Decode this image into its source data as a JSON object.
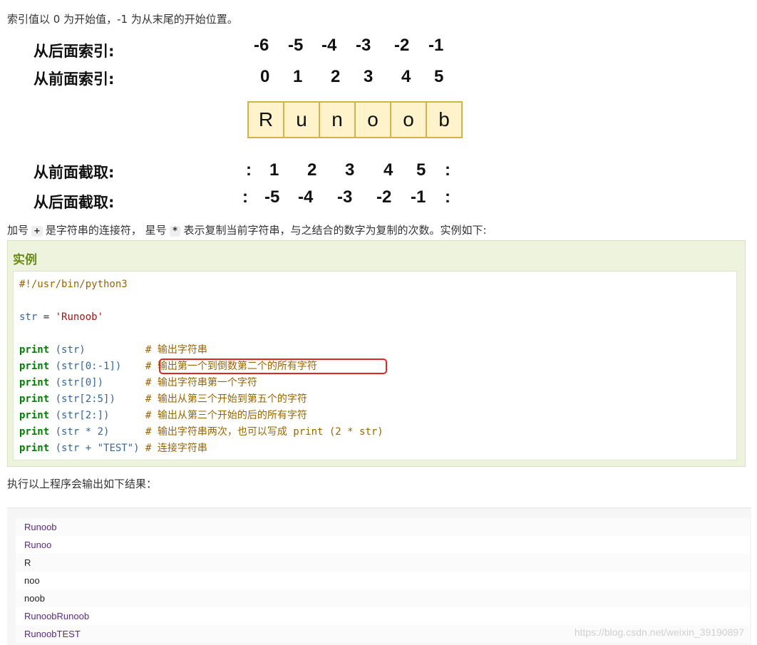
{
  "intro_text": "索引值以 0 为开始值，-1 为从末尾的开始位置。",
  "diagram": {
    "labels": {
      "from_back_index": "从后面索引:",
      "from_front_index": "从前面索引:",
      "from_front_slice": "从前面截取:",
      "from_back_slice": "从后面截取:"
    },
    "back_index": [
      "-6",
      "-5",
      "-4",
      "-3",
      "-2",
      "-1"
    ],
    "front_index": [
      "0",
      "1",
      "2",
      "3",
      "4",
      "5"
    ],
    "letters": [
      "R",
      "u",
      "n",
      "o",
      "o",
      "b"
    ],
    "front_slice": [
      ":",
      "1",
      "2",
      "3",
      "4",
      "5",
      ":"
    ],
    "back_slice": [
      ":",
      "-5",
      "-4",
      "-3",
      "-2",
      "-1",
      ":"
    ]
  },
  "concat_text": {
    "part1": "加号",
    "plus": "+",
    "part2": "是字符串的连接符， 星号",
    "star": "*",
    "part3": "表示复制当前字符串，与之结合的数字为复制的次数。实例如下:"
  },
  "example": {
    "title": "实例",
    "code": {
      "shebang": "#!/usr/bin/python3",
      "assign_var": "str",
      "assign_eq": " = ",
      "assign_val": "'Runoob'",
      "lines": [
        {
          "kw": "print",
          "arg": " (str)          ",
          "comment": "# 输出字符串"
        },
        {
          "kw": "print",
          "arg": " (str[0:-1])    ",
          "comment": "# 输出第一个到倒数第二个的所有字符"
        },
        {
          "kw": "print",
          "arg": " (str[0])       ",
          "comment": "# 输出字符串第一个字符"
        },
        {
          "kw": "print",
          "arg": " (str[2:5])     ",
          "comment": "# 输出从第三个开始到第五个的字符"
        },
        {
          "kw": "print",
          "arg": " (str[2:])      ",
          "comment": "# 输出从第三个开始的后的所有字符"
        },
        {
          "kw": "print",
          "arg": " (str * 2)      ",
          "comment": "# 输出字符串两次，也可以写成 print (2 * str)"
        },
        {
          "kw": "print",
          "arg": " (str + \"TEST\") ",
          "comment": "# 连接字符串"
        }
      ]
    }
  },
  "result_text": "执行以上程序会输出如下结果：",
  "output_lines": [
    "Runoob",
    "Runoo",
    "R",
    "noo",
    "noob",
    "RunoobRunoob",
    "RunoobTEST"
  ],
  "watermark": "https://blog.csdn.net/weixin_39190897"
}
